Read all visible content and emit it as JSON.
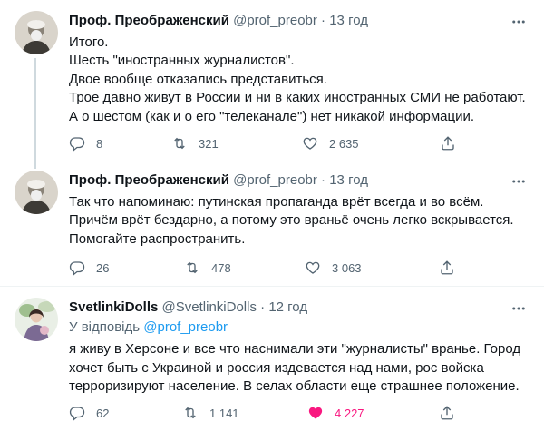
{
  "colors": {
    "accent": "#1d9bf0",
    "like": "#f91880",
    "muted": "#536471",
    "text": "#0f1419"
  },
  "tweets": [
    {
      "name": "Проф. Преображенский",
      "handle": "@prof_preobr",
      "dot": "·",
      "time": "13 год",
      "avatar": "portrait-avatar-professor",
      "lines": [
        "Итого.",
        "Шесть \"иностранных журналистов\".",
        "Двое вообще отказались представиться.",
        "Трое давно живут в России и ни в каких иностранных СМИ не работают.",
        "А о шестом (как и о его \"телеканале\") нет никакой информации."
      ],
      "stats": {
        "replies": "8",
        "retweets": "321",
        "likes": "2 635"
      }
    },
    {
      "name": "Проф. Преображенский",
      "handle": "@prof_preobr",
      "dot": "·",
      "time": "13 год",
      "avatar": "portrait-avatar-professor",
      "lines": [
        "Так что напоминаю: путинская пропаганда врёт всегда и во всём.",
        "Причём врёт бездарно, а потому это враньё очень легко вскрывается.",
        "Помогайте распространить."
      ],
      "stats": {
        "replies": "26",
        "retweets": "478",
        "likes": "3 063"
      }
    },
    {
      "name": "SvetlinkiDolls",
      "handle": "@SvetlinkiDolls",
      "dot": "·",
      "time": "12 год",
      "avatar": "photo-avatar-woman",
      "reply_prefix": "У відповідь",
      "reply_link": "@prof_preobr",
      "lines": [
        "я живу в Херсоне и все что наснимали эти \"журналисты\" вранье. Город",
        "хочет быть с Украиной и россия издевается над нами, рос войска",
        "терроризируют население. В селах области еще страшнее положение."
      ],
      "stats": {
        "replies": "62",
        "retweets": "1 141",
        "likes": "4 227"
      }
    }
  ]
}
